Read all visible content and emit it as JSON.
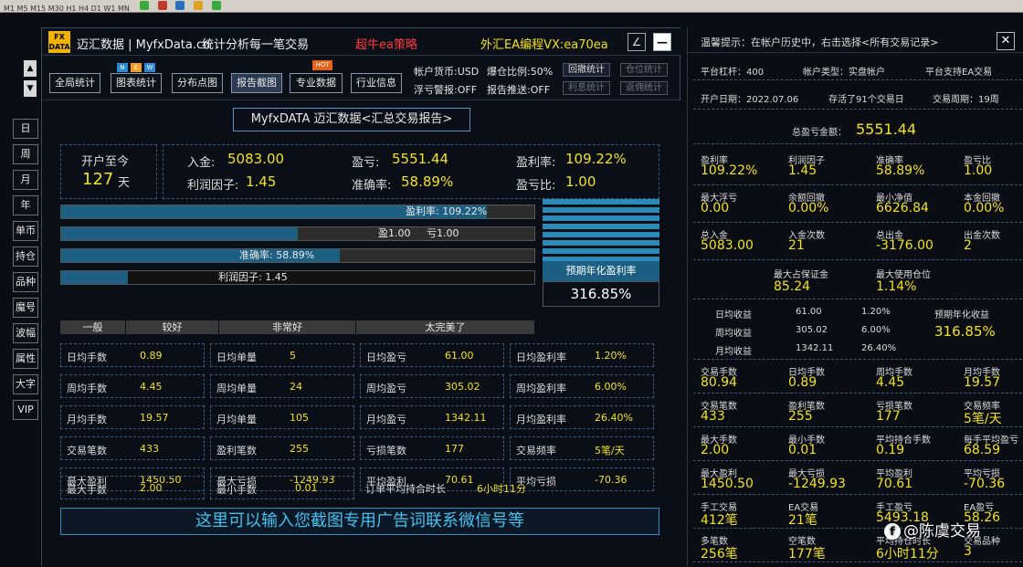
{
  "window": {
    "brand": "迈汇数据 | MyfxData.cn",
    "subtitle": "统计分析每一笔交易",
    "promo": "超牛ea策略",
    "contact": "外汇EA编程VX:ea70ea",
    "logo_top": "FX",
    "logo_bottom": "DATA",
    "btn_edit": "∠",
    "btn_min": "—"
  },
  "sidebar": {
    "items": [
      "日",
      "周",
      "月",
      "年",
      "单币",
      "持仓",
      "品种",
      "魔号",
      "波幅",
      "属性",
      "大字",
      "VIP"
    ],
    "up": "▲",
    "down": "▼"
  },
  "toolbar": {
    "tabs": [
      "全局统计",
      "图表统计",
      "分布点图",
      "报告截图",
      "专业数据",
      "行业信息"
    ],
    "new_badge": [
      "N",
      "E",
      "W"
    ],
    "hot_badge": "HOT",
    "currency": "帐户货币:USD",
    "margin_ratio": "爆仓比例:50%",
    "float_warn": "浮亏警报:OFF",
    "report_push": "报告推送:OFF",
    "btns": [
      "回撤统计",
      "仓位统计",
      "利息统计",
      "返佣统计"
    ]
  },
  "report": {
    "title": "MyfxDATA 迈汇数据<汇总交易报告>",
    "since_label": "开户至今",
    "since_days": "127",
    "since_unit": "天",
    "deposit_label": "入金:",
    "deposit": "5083.00",
    "pnl_label": "盈亏:",
    "pnl": "5551.44",
    "profit_rate_label": "盈利率:",
    "profit_rate": "109.22%",
    "profit_factor_label": "利润因子:",
    "profit_factor": "1.45",
    "accuracy_label": "准确率:",
    "accuracy": "58.89%",
    "pl_ratio_label": "盈亏比:",
    "pl_ratio": "1.00",
    "bar_profit_rate": "盈利率: 109.22%",
    "bar_win": "盈1.00",
    "bar_loss": "亏1.00",
    "bar_accuracy": "准确率: 58.89%",
    "bar_factor": "利润因子: 1.45",
    "grades": [
      "一般",
      "较好",
      "非常好",
      "太完美了"
    ],
    "annual_label": "预期年化盈利率",
    "annual_value": "316.85%",
    "levels": {
      "profit_rate": 0.9,
      "win": 0.5,
      "accuracy": 0.5886,
      "factor": 0.14
    },
    "grid": [
      [
        [
          "日均手数",
          "0.89"
        ],
        [
          "日均单量",
          "5"
        ],
        [
          "日均盈亏",
          "61.00"
        ],
        [
          "日均盈利率",
          "1.20%"
        ]
      ],
      [
        [
          "周均手数",
          "4.45"
        ],
        [
          "周均单量",
          "24"
        ],
        [
          "周均盈亏",
          "305.02"
        ],
        [
          "周均盈利率",
          "6.00%"
        ]
      ],
      [
        [
          "月均手数",
          "19.57"
        ],
        [
          "月均单量",
          "105"
        ],
        [
          "月均盈亏",
          "1342.11"
        ],
        [
          "月均盈利率",
          "26.40%"
        ]
      ],
      [
        [
          "交易笔数",
          "433"
        ],
        [
          "盈利笔数",
          "255"
        ],
        [
          "亏损笔数",
          "177"
        ],
        [
          "交易频率",
          "5笔/天"
        ]
      ],
      [
        [
          "最大盈利",
          "1450.50"
        ],
        [
          "最大亏损",
          "-1249.93"
        ],
        [
          "平均盈利",
          "70.61"
        ],
        [
          "平均亏损",
          "-70.36"
        ]
      ]
    ],
    "last_row": [
      [
        "最大手数",
        "2.00"
      ],
      [
        "最小手数",
        "0.01"
      ],
      [
        "订单平均持合时长",
        "6小时11分"
      ]
    ],
    "ad_text": "这里可以输入您截图专用广告词联系微信号等"
  },
  "right": {
    "tip": "温馨提示：在帐户历史中，右击选择<所有交易记录>",
    "close": "✕",
    "lev": "平台杠杆：400",
    "acct_type": "帐户类型：实盘帐户",
    "ea_support": "平台支持EA交易",
    "open_date": "开户日期：2022.07.06",
    "days": "存活了91个交易日",
    "period": "交易周期：19周",
    "total_label": "总盈亏金额：",
    "total": "5551.44",
    "stats1": [
      [
        "盈利率",
        "109.22%"
      ],
      [
        "利润因子",
        "1.45"
      ],
      [
        "准确率",
        "58.89%"
      ],
      [
        "盈亏比",
        "1.00"
      ]
    ],
    "stats2": [
      [
        "最大浮亏",
        "0.00"
      ],
      [
        "余额回撤",
        "0.00%"
      ],
      [
        "最小净值",
        "6626.84"
      ],
      [
        "本金回撤",
        "0.00%"
      ]
    ],
    "stats3": [
      [
        "总入金",
        "5083.00"
      ],
      [
        "入金次数",
        "21"
      ],
      [
        "总出金",
        "-3176.00"
      ],
      [
        "出金次数",
        "2"
      ]
    ],
    "stats4": [
      [
        "最大占保证金",
        "85.24"
      ],
      [
        "最大使用仓位",
        "1.14%"
      ]
    ],
    "period_rows": [
      [
        "日均收益",
        "61.00",
        "1.20%"
      ],
      [
        "周均收益",
        "305.02",
        "6.00%"
      ],
      [
        "月均收益",
        "1342.11",
        "26.40%"
      ]
    ],
    "annual_label": "预期年化收益",
    "annual": "316.85%",
    "stats5": [
      [
        "交易手数",
        "80.94"
      ],
      [
        "日均手数",
        "0.89"
      ],
      [
        "周均手数",
        "4.45"
      ],
      [
        "月均手数",
        "19.57"
      ]
    ],
    "stats6": [
      [
        "交易笔数",
        "433"
      ],
      [
        "盈利笔数",
        "255"
      ],
      [
        "亏损笔数",
        "177"
      ],
      [
        "交易频率",
        "5笔/天"
      ]
    ],
    "stats7": [
      [
        "最大手数",
        "2.00"
      ],
      [
        "最小手数",
        "0.01"
      ],
      [
        "平均持合手数",
        "0.19"
      ],
      [
        "每手平均盈亏",
        "68.59"
      ]
    ],
    "stats8": [
      [
        "最大盈利",
        "1450.50"
      ],
      [
        "最大亏损",
        "-1249.93"
      ],
      [
        "平均盈利",
        "70.61"
      ],
      [
        "平均亏损",
        "-70.36"
      ]
    ],
    "stats9": [
      [
        "手工交易",
        "412笔"
      ],
      [
        "EA交易",
        "21笔"
      ],
      [
        "手工盈亏",
        "5493.18"
      ],
      [
        "EA盈亏",
        "58.26"
      ]
    ],
    "stats10": [
      [
        "多笔数",
        "256笔"
      ],
      [
        "空笔数",
        "177笔"
      ],
      [
        "平均持仓时长",
        "6小时11分"
      ],
      [
        "交易品种",
        "3"
      ]
    ]
  },
  "watermark": {
    "icon": "f",
    "text": "@陈虞交易"
  }
}
